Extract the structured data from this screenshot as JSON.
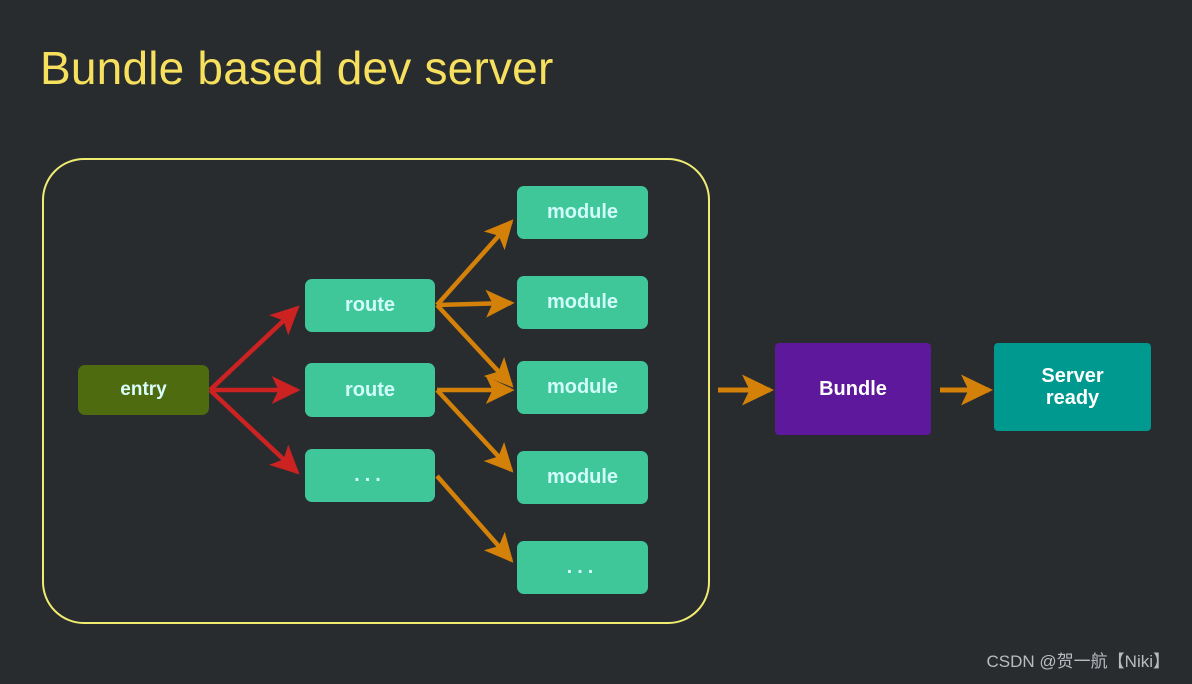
{
  "page": {
    "title": "Bundle based dev server",
    "background_color": "#282c2f",
    "title_color": "#f6e05e",
    "watermark": "CSDN @贺一航【Niki】"
  },
  "frame": {
    "label": "dependency-graph-frame",
    "border_color": "#f0ec72"
  },
  "nodes": {
    "entry": {
      "label": "entry",
      "color": "#4e6b10",
      "text_color": "#d9fdfb"
    },
    "route1": {
      "label": "route",
      "color": "#3fc79a",
      "text_color": "#d2fcfa"
    },
    "route2": {
      "label": "route",
      "color": "#3fc79a",
      "text_color": "#d2fcfa"
    },
    "route3": {
      "label": "...",
      "color": "#3fc79a",
      "text_color": "#d2fcfa"
    },
    "module1": {
      "label": "module",
      "color": "#3fc79a",
      "text_color": "#d2fcfa"
    },
    "module2": {
      "label": "module",
      "color": "#3fc79a",
      "text_color": "#d2fcfa"
    },
    "module3": {
      "label": "module",
      "color": "#3fc79a",
      "text_color": "#d2fcfa"
    },
    "module4": {
      "label": "module",
      "color": "#3fc79a",
      "text_color": "#d2fcfa"
    },
    "module5": {
      "label": "...",
      "color": "#3fc79a",
      "text_color": "#d2fcfa"
    },
    "bundle": {
      "label": "Bundle",
      "color": "#5d189b",
      "text_color": "#ffffff"
    },
    "server": {
      "label": "Server\nready",
      "line1": "Server",
      "line2": "ready",
      "color": "#00998f",
      "text_color": "#ffffff"
    }
  },
  "edges": {
    "entry_arrow_color": "#cc2222",
    "module_arrow_color": "#d4810a",
    "flow_arrow_color": "#d4810a",
    "connections": [
      {
        "from": "entry",
        "to": "route1",
        "color": "#cc2222"
      },
      {
        "from": "entry",
        "to": "route2",
        "color": "#cc2222"
      },
      {
        "from": "entry",
        "to": "route3",
        "color": "#cc2222"
      },
      {
        "from": "route1",
        "to": "module1",
        "color": "#d4810a"
      },
      {
        "from": "route1",
        "to": "module2",
        "color": "#d4810a"
      },
      {
        "from": "route1",
        "to": "module3",
        "color": "#d4810a"
      },
      {
        "from": "route2",
        "to": "module3",
        "color": "#d4810a"
      },
      {
        "from": "route2",
        "to": "module4",
        "color": "#d4810a"
      },
      {
        "from": "route3",
        "to": "module5",
        "color": "#d4810a"
      },
      {
        "from": "frame",
        "to": "bundle",
        "color": "#d4810a"
      },
      {
        "from": "bundle",
        "to": "server",
        "color": "#d4810a"
      }
    ]
  }
}
